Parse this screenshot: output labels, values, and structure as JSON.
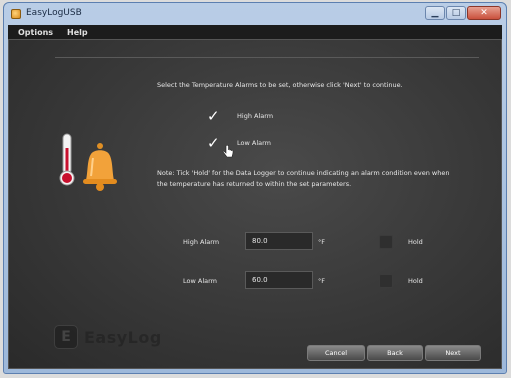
{
  "window": {
    "title": "EasyLogUSB"
  },
  "menu": {
    "items": [
      "Options",
      "Help"
    ]
  },
  "main": {
    "instruction": "Select the Temperature Alarms to be set, otherwise click 'Next' to continue.",
    "checks": [
      {
        "label": "High Alarm",
        "checked": true
      },
      {
        "label": "Low Alarm",
        "checked": true
      }
    ],
    "note": "Note: Tick 'Hold' for the Data Logger to continue indicating an alarm condition even when the temperature has returned to within the set parameters.",
    "fields": [
      {
        "label": "High Alarm",
        "value": "80.0",
        "unit": "°F",
        "hold_label": "Hold"
      },
      {
        "label": "Low Alarm",
        "value": "60.0",
        "unit": "°F",
        "hold_label": "Hold"
      }
    ]
  },
  "brand": {
    "text": "EasyLog"
  },
  "buttons": {
    "cancel": "Cancel",
    "back": "Back",
    "next": "Next"
  },
  "colors": {
    "accent_orange": "#f2a23a",
    "thermometer_red": "#c8102e",
    "window_blue": "#9db8da"
  }
}
